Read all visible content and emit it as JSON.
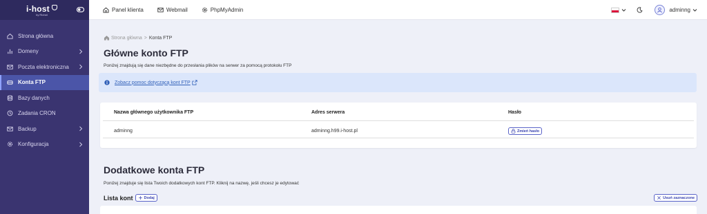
{
  "brand": {
    "name": "i-host",
    "sub": "by Richat"
  },
  "sidebar": {
    "items": [
      {
        "label": "Strona główna",
        "icon": "home-icon",
        "chevron": false,
        "active": false
      },
      {
        "label": "Domeny",
        "icon": "bar-chart-icon",
        "chevron": true,
        "active": false
      },
      {
        "label": "Poczta elektroniczna",
        "icon": "mail-icon",
        "chevron": true,
        "active": false
      },
      {
        "label": "Konta FTP",
        "icon": "drive-icon",
        "chevron": false,
        "active": true
      },
      {
        "label": "Bazy danych",
        "icon": "database-icon",
        "chevron": false,
        "active": false
      },
      {
        "label": "Zadania CRON",
        "icon": "clock-icon",
        "chevron": false,
        "active": false
      },
      {
        "label": "Backup",
        "icon": "archive-icon",
        "chevron": true,
        "active": false
      },
      {
        "label": "Konfiguracja",
        "icon": "gear-icon",
        "chevron": true,
        "active": false
      }
    ]
  },
  "topbar": {
    "links": [
      {
        "label": "Panel klienta",
        "icon": "home-icon"
      },
      {
        "label": "Webmail",
        "icon": "mail-icon"
      },
      {
        "label": "PhpMyAdmin",
        "icon": "gear-icon"
      }
    ],
    "user": "adminng",
    "language": "pl"
  },
  "breadcrumb": {
    "home": "Strona główna",
    "separator": ">",
    "current": "Konta FTP"
  },
  "main_account": {
    "title": "Główne konto FTP",
    "description": "Poniżej znajdują się dane niezbędne do przesłania plików na serwer za pomocą protokołu FTP",
    "help_link": "Zobacz pomoc dotyczącą kont FTP",
    "columns": [
      "Nazwa głównego użytkownika FTP",
      "Adres serwera",
      "Hasło"
    ],
    "row": {
      "user": "adminng",
      "server": "adminng.h99.i-host.pl",
      "password_button": "Zmień hasło"
    }
  },
  "additional": {
    "title": "Dodatkowe konta FTP",
    "description": "Poniżej znajduje się lista Twoich dodatkowych kont FTP. Kliknij na nazwę, jeśli chcesz je edytować",
    "list_title": "Lista kont",
    "add_button": "Dodaj",
    "delete_button": "Usuń zaznaczone"
  },
  "colors": {
    "sidebar": "#3a3470",
    "active": "#4b55a8",
    "accent": "#3a44b0",
    "info_bg": "#dbe6fb"
  }
}
